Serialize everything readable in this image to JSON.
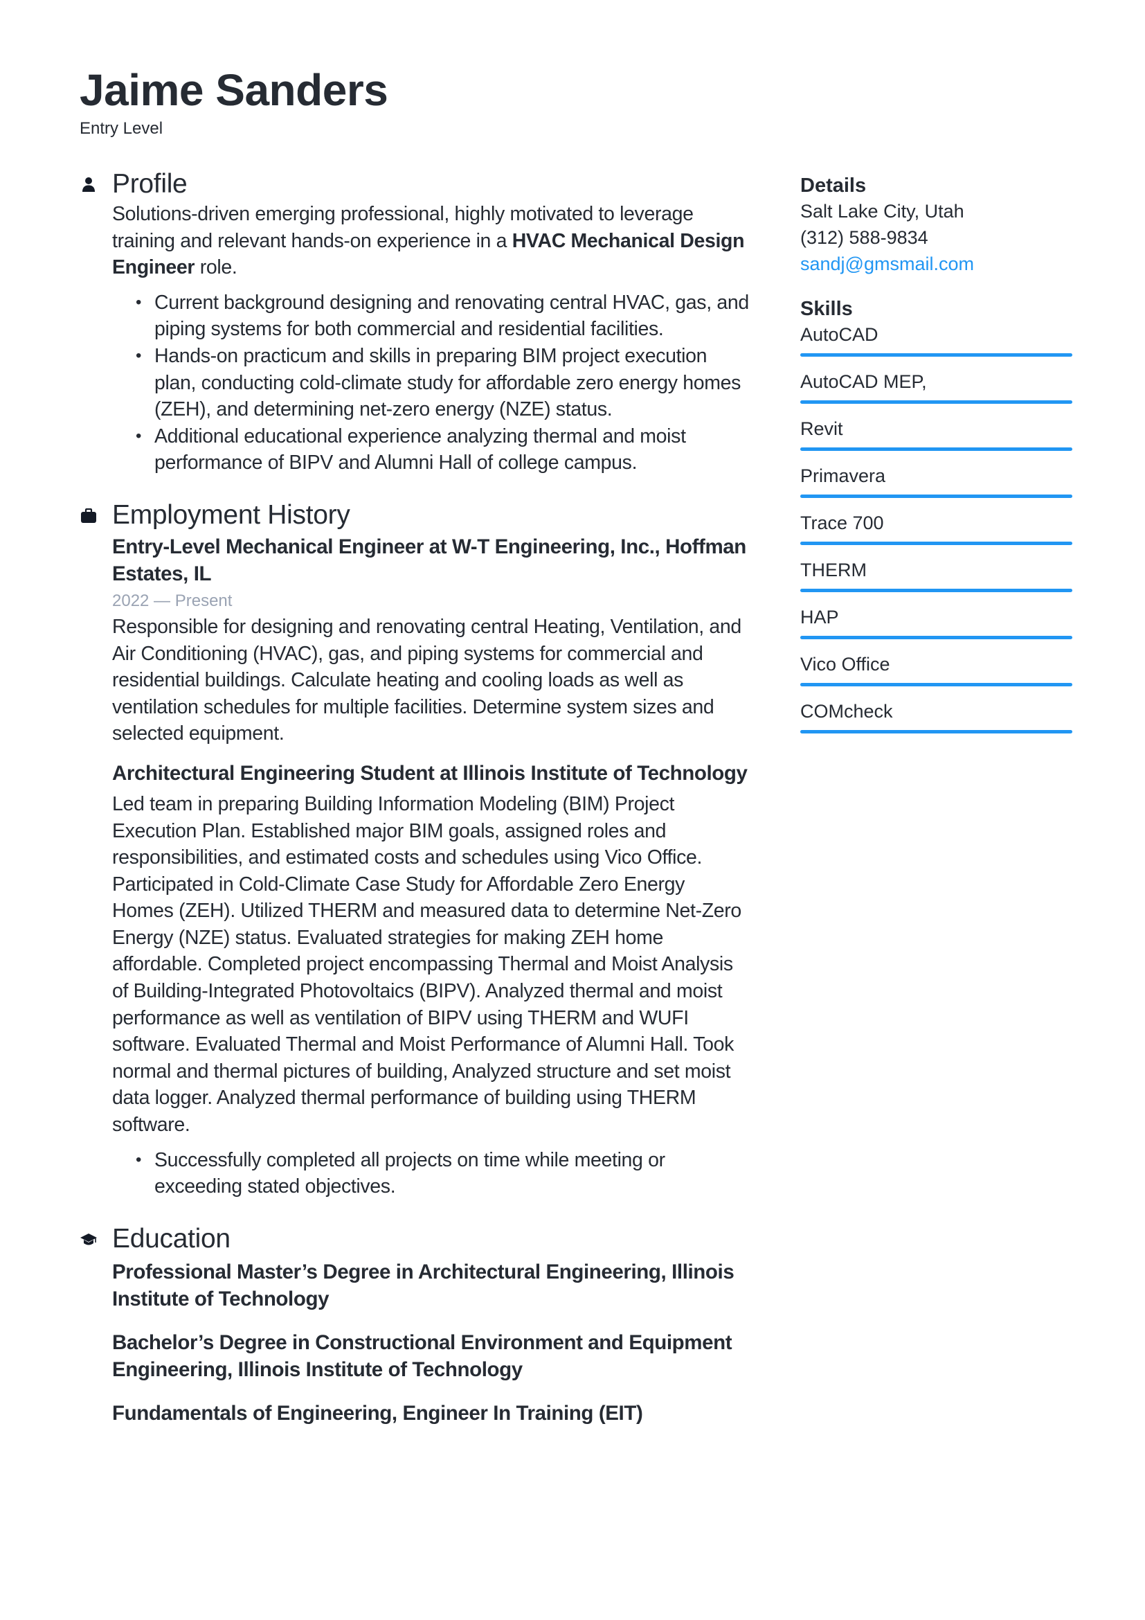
{
  "header": {
    "name": "Jaime Sanders",
    "subtitle": "Entry Level"
  },
  "profile": {
    "title": "Profile",
    "icon": "person-icon",
    "summary_before": "Solutions-driven emerging professional, highly motivated to leverage training and relevant hands-on experience in a ",
    "summary_bold": "HVAC Mechanical Design Engineer",
    "summary_after": " role.",
    "bullets": [
      "Current background designing and renovating central HVAC, gas, and piping systems for both commercial and residential facilities.",
      "Hands-on practicum and skills in preparing BIM project execution plan, conducting cold-climate study for affordable zero energy homes (ZEH), and determining net-zero energy (NZE) status.",
      "Additional educational experience analyzing thermal and moist performance of BIPV and Alumni Hall of college campus."
    ]
  },
  "employment": {
    "title": "Employment History",
    "icon": "briefcase-icon",
    "jobs": [
      {
        "title": "Entry-Level Mechanical Engineer at W-T Engineering, Inc., Hoffman Estates, IL",
        "date": "2022 — Present",
        "description": "Responsible for designing and renovating central Heating, Ventilation, and Air Conditioning (HVAC), gas, and piping systems for commercial and residential buildings. Calculate heating and cooling loads as well as ventilation schedules for multiple facilities. Determine system sizes and selected equipment."
      },
      {
        "title": "Architectural Engineering Student  at Illinois Institute of Technology",
        "description": "Led team in preparing Building Information Modeling (BIM) Project Execution Plan. Established major BIM goals, assigned roles and responsibilities, and estimated costs and schedules using Vico Office. Participated in Cold-Climate Case Study for Affordable Zero Energy Homes (ZEH). Utilized THERM and measured data to determine Net-Zero Energy (NZE) status. Evaluated strategies for making ZEH home affordable. Completed project encompassing Thermal and Moist Analysis of Building-Integrated Photovoltaics (BIPV). Analyzed thermal and moist performance as well as ventilation of BIPV using THERM and WUFI software. Evaluated Thermal and Moist Performance of Alumni Hall. Took normal and thermal pictures of building, Analyzed structure and set moist data logger. Analyzed thermal performance of building using THERM software.",
        "bullets": [
          "Successfully completed all projects on time while meeting or exceeding stated objectives."
        ]
      }
    ]
  },
  "education": {
    "title": "Education",
    "icon": "graduation-cap-icon",
    "items": [
      "Professional Master’s Degree in Architectural Engineering, Illinois Institute of Technology",
      "Bachelor’s Degree in Constructional Environment and Equipment Engineering, Illinois Institute of Technology",
      "Fundamentals of Engineering, Engineer In Training (EIT)"
    ]
  },
  "details": {
    "title": "Details",
    "location": "Salt Lake City, Utah",
    "phone": "(312) 588-9834",
    "email": "sandj@gmsmail.com"
  },
  "skills": {
    "title": "Skills",
    "items": [
      {
        "name": "AutoCAD",
        "level": 1.0
      },
      {
        "name": "AutoCAD MEP,",
        "level": 1.0
      },
      {
        "name": "Revit",
        "level": 1.0
      },
      {
        "name": "Primavera",
        "level": 1.0
      },
      {
        "name": "Trace 700",
        "level": 1.0
      },
      {
        "name": "THERM",
        "level": 1.0
      },
      {
        "name": "HAP",
        "level": 1.0
      },
      {
        "name": "Vico Office",
        "level": 1.0
      },
      {
        "name": "COMcheck",
        "level": 1.0
      }
    ]
  },
  "colors": {
    "text": "#262b33",
    "accent": "#2196f3",
    "muted": "#9aa3b3"
  }
}
